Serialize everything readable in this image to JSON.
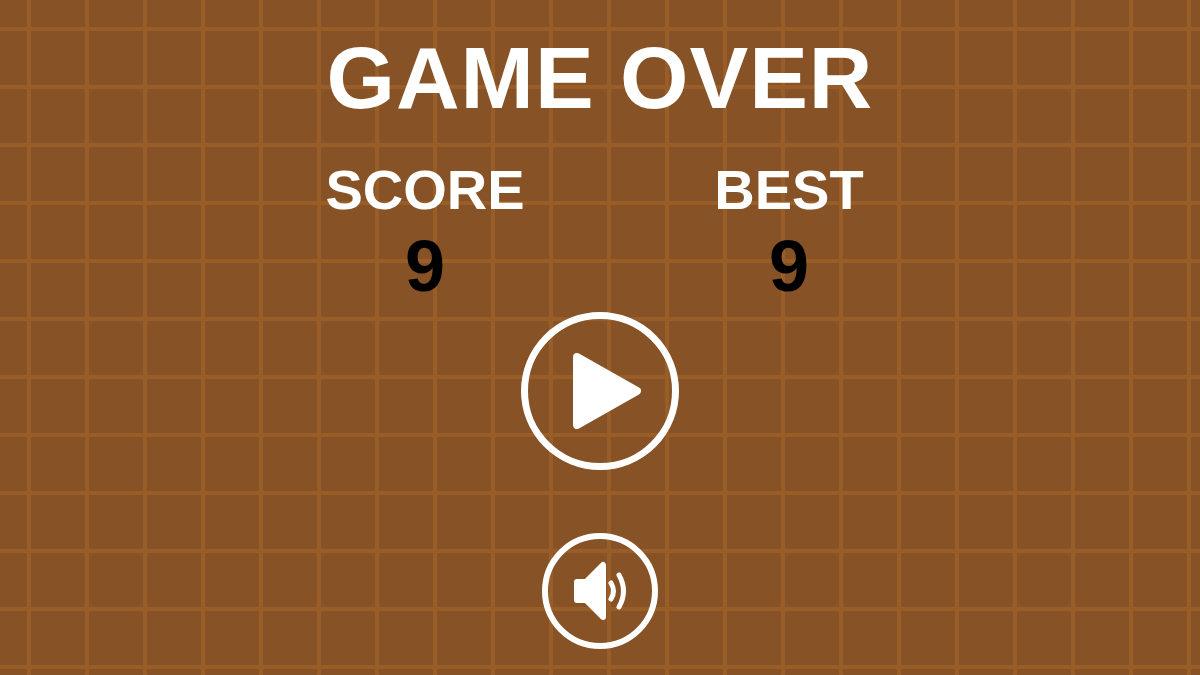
{
  "title": "GAME OVER",
  "stats": [
    {
      "label": "SCORE",
      "value": "9"
    },
    {
      "label": "BEST",
      "value": "9"
    }
  ],
  "buttons": [
    {
      "kind": "play"
    },
    {
      "kind": "sound",
      "on": true
    }
  ]
}
